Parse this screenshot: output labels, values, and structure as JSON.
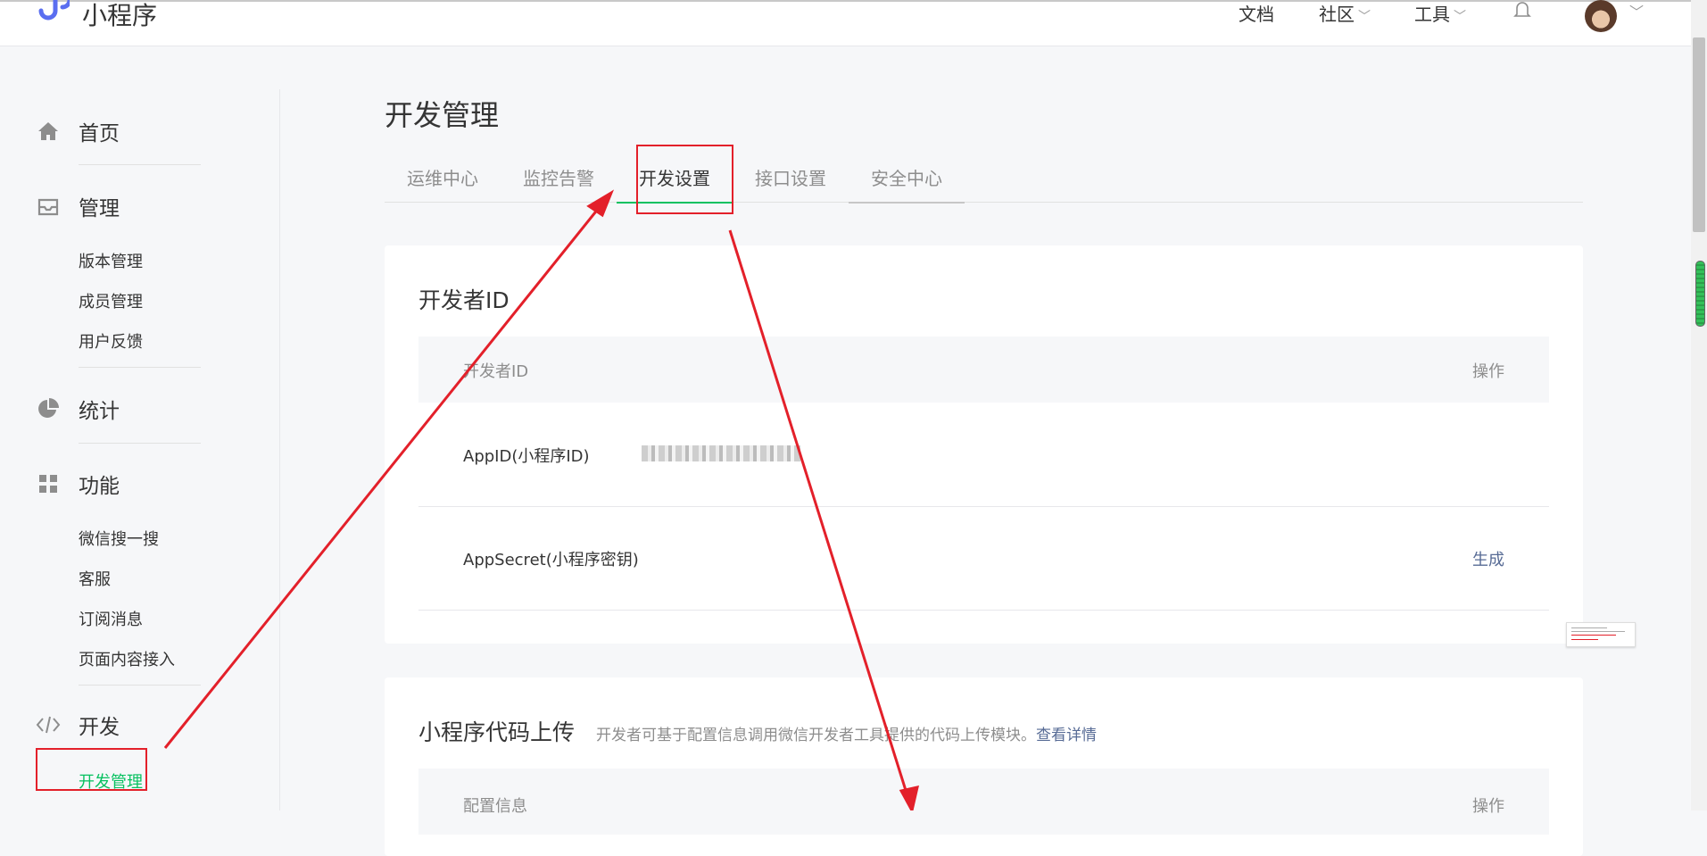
{
  "header": {
    "logo_text": "小程序",
    "nav": [
      {
        "label": "文档",
        "has_caret": false
      },
      {
        "label": "社区",
        "has_caret": true
      },
      {
        "label": "工具",
        "has_caret": true
      }
    ]
  },
  "sidebar": {
    "groups": [
      {
        "label": "首页",
        "icon": "home-icon",
        "items": []
      },
      {
        "label": "管理",
        "icon": "inbox-icon",
        "items": [
          "版本管理",
          "成员管理",
          "用户反馈"
        ]
      },
      {
        "label": "统计",
        "icon": "pie-chart-icon",
        "items": []
      },
      {
        "label": "功能",
        "icon": "grid-icon",
        "items": [
          "微信搜一搜",
          "客服",
          "订阅消息",
          "页面内容接入"
        ]
      },
      {
        "label": "开发",
        "icon": "code-icon",
        "items": [
          "开发管理"
        ]
      }
    ],
    "active_item": "开发管理"
  },
  "main": {
    "title": "开发管理",
    "tabs": [
      "运维中心",
      "监控告警",
      "开发设置",
      "接口设置",
      "安全中心"
    ],
    "active_tab": "开发设置",
    "developer_id_card": {
      "title": "开发者ID",
      "columns": [
        "开发者ID",
        "操作"
      ],
      "rows": [
        {
          "label": "AppID(小程序ID)",
          "value": "(blurred)",
          "action": ""
        },
        {
          "label": "AppSecret(小程序密钥)",
          "value": "",
          "action": "生成"
        }
      ]
    },
    "upload_card": {
      "title": "小程序代码上传",
      "desc": "开发者可基于配置信息调用微信开发者工具提供的代码上传模块。",
      "link": "查看详情",
      "columns": [
        "配置信息",
        "操作"
      ]
    }
  },
  "colors": {
    "accent_green": "#07c160",
    "link_blue": "#576b95",
    "annotation_red": "#e3202a"
  }
}
